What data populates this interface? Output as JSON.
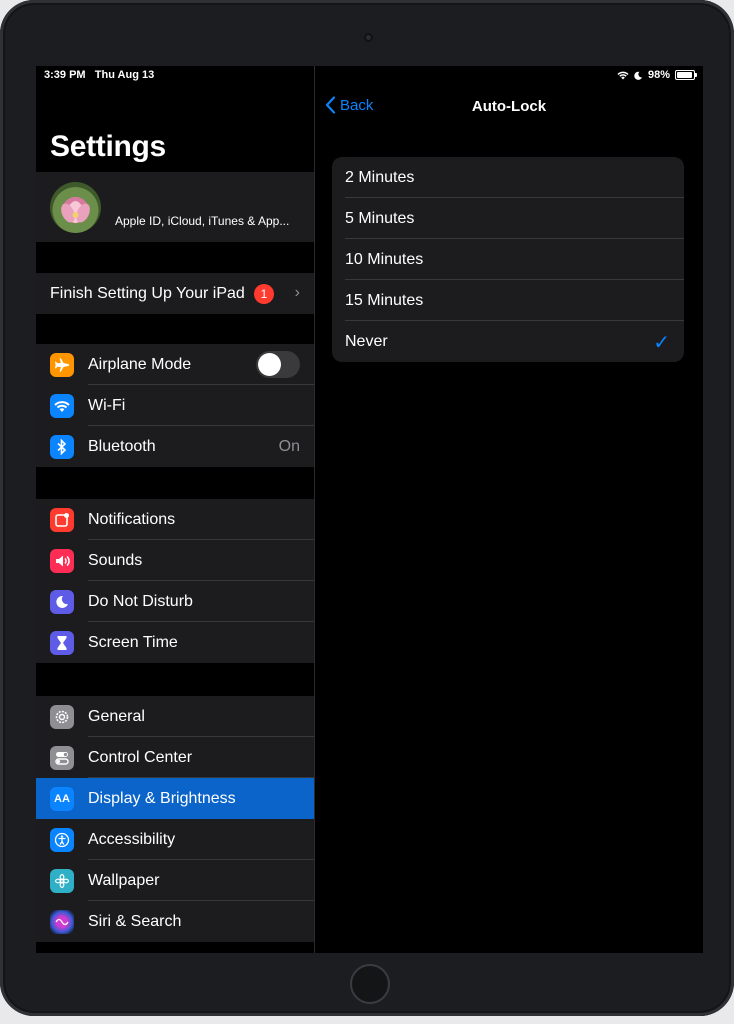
{
  "status": {
    "time": "3:39 PM",
    "date": "Thu Aug 13",
    "battery": "98%"
  },
  "sidebar": {
    "title": "Settings",
    "profile_subtitle": "Apple ID, iCloud, iTunes & App...",
    "finish": {
      "label": "Finish Setting Up Your iPad",
      "badge": "1"
    },
    "group1": [
      {
        "label": "Airplane Mode",
        "icon": "airplane-icon",
        "color": "#ff9500"
      },
      {
        "label": "Wi-Fi",
        "icon": "wifi-icon",
        "color": "#0a84ff"
      },
      {
        "label": "Bluetooth",
        "icon": "bluetooth-icon",
        "color": "#0a84ff",
        "value": "On"
      }
    ],
    "group2": [
      {
        "label": "Notifications",
        "icon": "notifications-icon",
        "color": "#ff3b30"
      },
      {
        "label": "Sounds",
        "icon": "sounds-icon",
        "color": "#ff2d55"
      },
      {
        "label": "Do Not Disturb",
        "icon": "moon-icon",
        "color": "#5e5ce6"
      },
      {
        "label": "Screen Time",
        "icon": "hourglass-icon",
        "color": "#5e5ce6"
      }
    ],
    "group3": [
      {
        "label": "General",
        "icon": "gear-icon",
        "color": "#8e8e93"
      },
      {
        "label": "Control Center",
        "icon": "control-center-icon",
        "color": "#8e8e93"
      },
      {
        "label": "Display & Brightness",
        "icon": "display-icon",
        "color": "#0a84ff",
        "selected": true
      },
      {
        "label": "Accessibility",
        "icon": "accessibility-icon",
        "color": "#0a84ff"
      },
      {
        "label": "Wallpaper",
        "icon": "wallpaper-icon",
        "color": "#30b0c7"
      },
      {
        "label": "Siri & Search",
        "icon": "siri-icon",
        "color": "#1c1c1e"
      }
    ]
  },
  "detail": {
    "back_label": "Back",
    "title": "Auto-Lock",
    "options": [
      "2 Minutes",
      "5 Minutes",
      "10 Minutes",
      "15 Minutes",
      "Never"
    ],
    "selected": "Never"
  }
}
